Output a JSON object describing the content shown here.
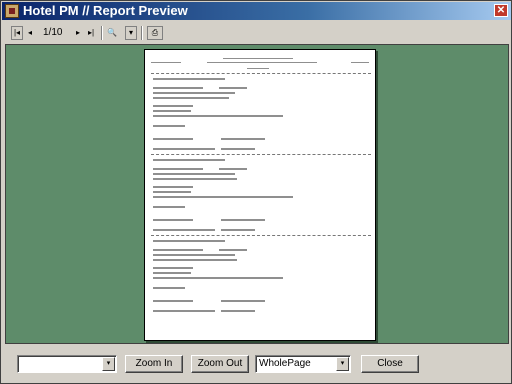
{
  "window": {
    "title": "Hotel PM // Report Preview",
    "close_glyph": "✕"
  },
  "toolbar": {
    "first_glyph": "|◂",
    "prev_glyph": "◂",
    "page_indicator": "1/10",
    "next_glyph": "▸",
    "last_glyph": "▸|",
    "zoom_glyph": "🔍",
    "dropdown_glyph": "▾",
    "print_glyph": "⎙"
  },
  "bottom": {
    "left_combo_value": "",
    "zoom_in_label": "Zoom In",
    "zoom_out_label": "Zoom Out",
    "zoom_combo_value": "WholePage",
    "close_label": "Close",
    "dropdown_glyph": "▾"
  },
  "icons": [
    "app-icon",
    "first-page-icon",
    "prev-page-icon",
    "next-page-icon",
    "last-page-icon",
    "zoom-icon",
    "print-icon",
    "close-icon"
  ]
}
